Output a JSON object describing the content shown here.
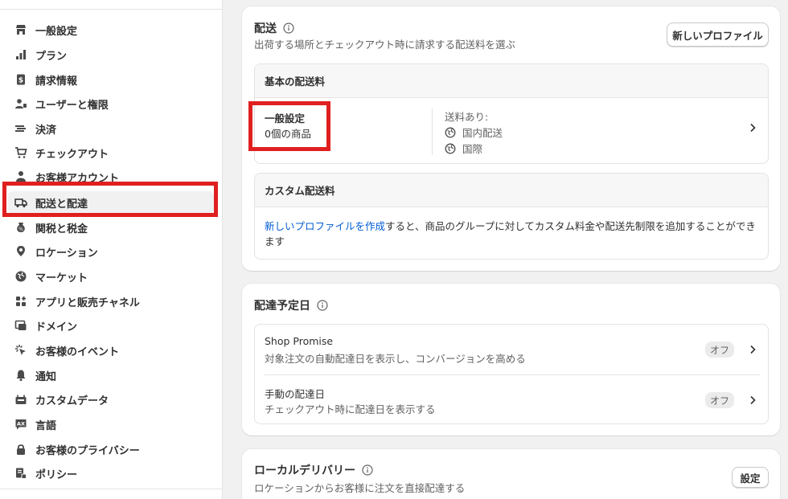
{
  "sidebar": {
    "items": [
      {
        "label": "一般設定",
        "icon": "store-icon"
      },
      {
        "label": "プラン",
        "icon": "chart-icon"
      },
      {
        "label": "請求情報",
        "icon": "receipt-icon"
      },
      {
        "label": "ユーザーと権限",
        "icon": "users-icon"
      },
      {
        "label": "決済",
        "icon": "payments-icon"
      },
      {
        "label": "チェックアウト",
        "icon": "cart-icon"
      },
      {
        "label": "お客様アカウント",
        "icon": "person-icon"
      },
      {
        "label": "配送と配達",
        "icon": "truck-icon"
      },
      {
        "label": "関税と税金",
        "icon": "tax-icon"
      },
      {
        "label": "ロケーション",
        "icon": "location-icon"
      },
      {
        "label": "マーケット",
        "icon": "globe-icon"
      },
      {
        "label": "アプリと販売チャネル",
        "icon": "apps-icon"
      },
      {
        "label": "ドメイン",
        "icon": "domain-icon"
      },
      {
        "label": "お客様のイベント",
        "icon": "events-icon"
      },
      {
        "label": "通知",
        "icon": "bell-icon"
      },
      {
        "label": "カスタムデータ",
        "icon": "data-icon"
      },
      {
        "label": "言語",
        "icon": "language-icon"
      },
      {
        "label": "お客様のプライバシー",
        "icon": "lock-icon"
      },
      {
        "label": "ポリシー",
        "icon": "policy-icon"
      }
    ],
    "active_index": 7
  },
  "shipping": {
    "title": "配送",
    "subtitle": "出荷する場所とチェックアウト時に請求する配送料を選ぶ",
    "new_profile_button": "新しいプロファイル",
    "basic_rates": {
      "header": "基本の配送料",
      "profile_name": "一般設定",
      "product_count": "0個の商品",
      "rates_label": "送料あり:",
      "zones": [
        "国内配送",
        "国際"
      ]
    },
    "custom_rates": {
      "header": "カスタム配送料",
      "link_text": "新しいプロファイルを作成",
      "body_text_1": "すると、商品のグループに対してカスタム料金や配送先制限を追加することができ",
      "body_text_2": "ます"
    }
  },
  "delivery_dates": {
    "title": "配達予定日",
    "rows": [
      {
        "title": "Shop Promise",
        "description": "対象注文の自動配達日を表示し、コンバージョンを高める",
        "status": "オフ"
      },
      {
        "title": "手動の配達日",
        "description": "チェックアウト時に配達日を表示する",
        "status": "オフ"
      }
    ]
  },
  "local_delivery": {
    "title": "ローカルデリバリー",
    "subtitle": "ロケーションからお客様に注文を直接配達する",
    "settings_button": "設定"
  },
  "colors": {
    "highlight": "#e02020",
    "link": "#005bd3",
    "badge_bg": "#ebebeb"
  }
}
